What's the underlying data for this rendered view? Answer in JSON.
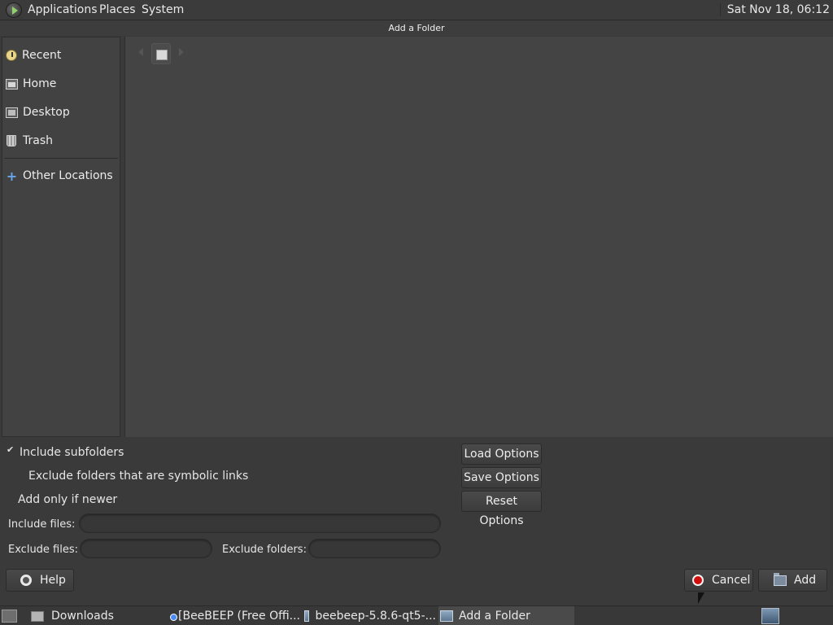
{
  "top_panel": {
    "menus": [
      "Applications",
      "Places",
      "System"
    ],
    "clock": "Sat Nov 18, 06:12"
  },
  "window": {
    "title": "Add a Folder"
  },
  "sidebar": {
    "items": [
      {
        "label": "Recent",
        "icon": "recent-icon"
      },
      {
        "label": "Home",
        "icon": "home-icon"
      },
      {
        "label": "Desktop",
        "icon": "desktop-icon"
      },
      {
        "label": "Trash",
        "icon": "trash-icon"
      },
      {
        "label": "Other Locations",
        "icon": "plus-icon"
      }
    ]
  },
  "options": {
    "include_subfolders": {
      "label": "Include subfolders",
      "checked": true
    },
    "exclude_symlinks": {
      "label": "Exclude folders that are symbolic links",
      "checked": false
    },
    "add_only_newer": {
      "label": "Add only if newer",
      "checked": false
    },
    "include_files_label": "Include files:",
    "include_files_value": "",
    "exclude_files_label": "Exclude files:",
    "exclude_files_value": "",
    "exclude_folders_label": "Exclude folders:",
    "exclude_folders_value": "",
    "load_options": "Load Options",
    "save_options": "Save Options",
    "reset_options": "Reset Options"
  },
  "buttons": {
    "help": "Help",
    "cancel": "Cancel",
    "add": "Add"
  },
  "taskbar": {
    "items": [
      {
        "label": "Downloads",
        "icon": "folder-icon",
        "active": false
      },
      {
        "label": "[BeeBEEP (Free Offi...",
        "icon": "chrome-icon",
        "active": false
      },
      {
        "label": "beebeep-5.8.6-qt5-...",
        "icon": "package-icon",
        "active": false
      },
      {
        "label": "Add a Folder",
        "icon": "package-icon",
        "active": true
      }
    ]
  }
}
